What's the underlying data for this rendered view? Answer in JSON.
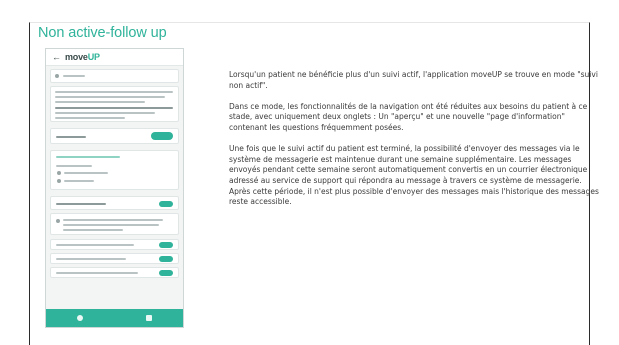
{
  "slide": {
    "title": "Non active-follow up"
  },
  "phone": {
    "back_icon": "arrow-left-icon",
    "logo_prefix": "move",
    "logo_accent": "UP",
    "accent_color": "#2fb39a"
  },
  "body": {
    "paragraphs": [
      "Lorsqu'un patient ne bénéficie plus d'un suivi actif, l'application moveUP se trouve en mode \"suivi non actif\".",
      "Dans ce mode, les fonctionnalités de la navigation ont été réduites aux besoins du patient à ce stade, avec uniquement deux onglets : Un \"aperçu\" et une nouvelle \"page d'information\" contenant les questions fréquemment posées.",
      "Une fois que le suivi actif du patient est terminé, la possibilité d'envoyer des messages via le système de messagerie est maintenue durant une semaine supplémentaire. Les messages envoyés pendant cette semaine seront automatiquement convertis en un courrier électronique adressé au service de support qui répondra au message à travers ce système de messagerie. Après cette période, il n'est plus possible d'envoyer des messages mais l'historique des messages reste accessible."
    ]
  }
}
